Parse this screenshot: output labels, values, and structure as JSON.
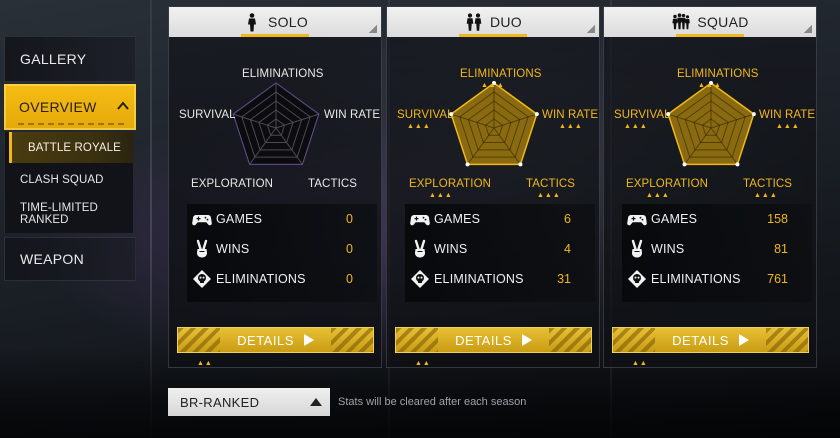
{
  "sidebar": {
    "gallery": "GALLERY",
    "overview": "OVERVIEW",
    "submenu": [
      "BATTLE ROYALE",
      "CLASH SQUAD",
      "TIME-LIMITED RANKED"
    ],
    "weapon": "WEAPON"
  },
  "radar_labels": {
    "eliminations": "ELIMINATIONS",
    "win_rate": "WIN RATE",
    "survival": "SURVIVAL",
    "exploration": "EXPLORATION",
    "tactics": "TACTICS"
  },
  "stat_labels": {
    "games": "GAMES",
    "wins": "WINS",
    "eliminations": "ELIMINATIONS"
  },
  "columns": [
    {
      "title": "SOLO",
      "icon": "solo-person-icon",
      "games": "0",
      "wins": "0",
      "eliminations": "0",
      "details": "DETAILS",
      "radar": {
        "eliminations": 0,
        "win_rate": 0,
        "survival": 0,
        "exploration": 0,
        "tactics": 0
      }
    },
    {
      "title": "DUO",
      "icon": "duo-people-icon",
      "games": "6",
      "wins": "4",
      "eliminations": "31",
      "details": "DETAILS",
      "radar": {
        "eliminations": 1,
        "win_rate": 1,
        "survival": 1,
        "exploration": 1,
        "tactics": 1
      }
    },
    {
      "title": "SQUAD",
      "icon": "squad-people-icon",
      "games": "158",
      "wins": "81",
      "eliminations": "761",
      "details": "DETAILS",
      "radar": {
        "eliminations": 1,
        "win_rate": 1,
        "survival": 1,
        "exploration": 1,
        "tactics": 1
      }
    }
  ],
  "mode_select": {
    "value": "BR-RANKED"
  },
  "hint": "Stats will be cleared after each season",
  "colors": {
    "accent": "#f2b81a",
    "radar_fill": "#8a6a10"
  }
}
